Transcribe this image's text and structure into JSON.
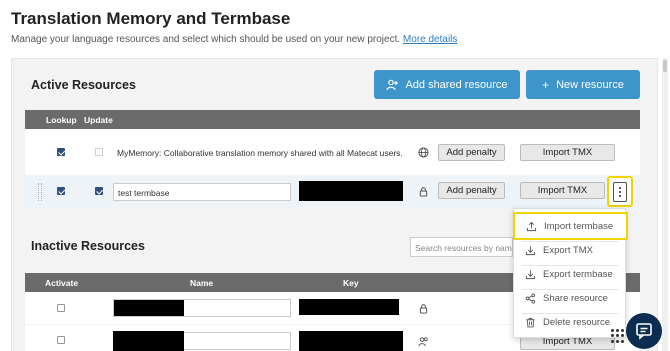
{
  "header": {
    "title": "Translation Memory and Termbase",
    "subtitle": "Manage your language resources and select which should be used on your new project.",
    "more_details": "More details"
  },
  "active": {
    "title": "Active Resources",
    "add_shared_label": "Add shared resource",
    "new_resource_label": "New resource",
    "columns": {
      "lookup": "Lookup",
      "update": "Update"
    },
    "rows": [
      {
        "name": "MyMemory: Collaborative translation memory shared with all Matecat users.",
        "lookup": true,
        "update": false,
        "add_penalty": "Add penalty",
        "import_tmx": "Import TMX"
      },
      {
        "name": "test termbase",
        "lookup": true,
        "update": true,
        "add_penalty": "Add penalty",
        "import_tmx": "Import TMX"
      }
    ]
  },
  "inactive": {
    "title": "Inactive Resources",
    "search_placeholder": "Search resources by name",
    "columns": {
      "activate": "Activate",
      "name": "Name",
      "key": "Key"
    },
    "rows": [
      {
        "activate": false,
        "import_tmx": ""
      },
      {
        "activate": false,
        "import_tmx": "Import TMX"
      }
    ]
  },
  "menu": {
    "items": [
      {
        "label": "Import termbase",
        "icon": "upload-icon"
      },
      {
        "label": "Export TMX",
        "icon": "download-icon"
      },
      {
        "label": "Export termbase",
        "icon": "download-icon"
      },
      {
        "label": "Share resource",
        "icon": "share-icon"
      },
      {
        "label": "Delete resource",
        "icon": "trash-icon"
      }
    ]
  },
  "colors": {
    "primary": "#3d95c9",
    "table_header": "#6b6b6b",
    "highlight": "#f2d400",
    "chat": "#0b2d4f"
  }
}
